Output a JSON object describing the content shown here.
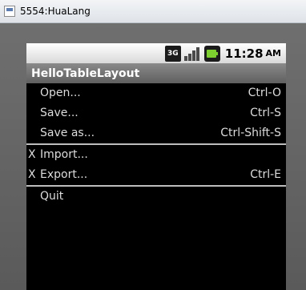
{
  "window": {
    "title": "5554:HuaLang"
  },
  "statusbar": {
    "network_label": "3G",
    "time": "11:28",
    "ampm": "AM"
  },
  "app": {
    "title": "HelloTableLayout"
  },
  "menu": {
    "rows": [
      {
        "mark": "",
        "label": "Open...",
        "shortcut": "Ctrl-O"
      },
      {
        "mark": "",
        "label": "Save...",
        "shortcut": "Ctrl-S"
      },
      {
        "mark": "",
        "label": "Save as...",
        "shortcut": "Ctrl-Shift-S"
      },
      {
        "mark": "X",
        "label": "Import...",
        "shortcut": ""
      },
      {
        "mark": "X",
        "label": "Export...",
        "shortcut": "Ctrl-E"
      },
      {
        "mark": "",
        "label": "Quit",
        "shortcut": ""
      }
    ]
  },
  "colors": {
    "screen_bg": "#000000",
    "text": "#dcdcdc",
    "divider": "#bdbdbd",
    "appbar": "#6f6f6f",
    "battery": "#7ccf2f"
  }
}
